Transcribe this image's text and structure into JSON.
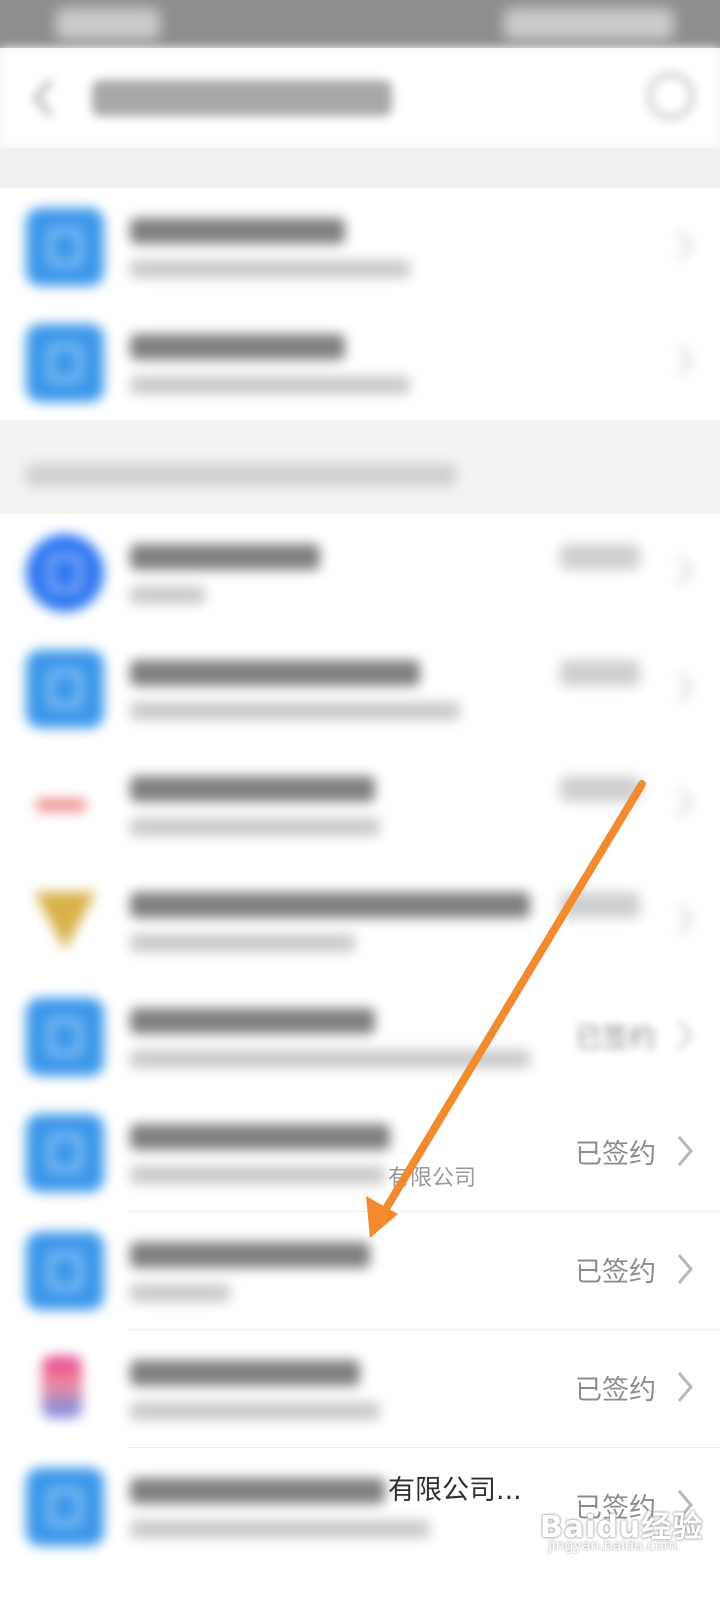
{
  "list": {
    "status_signed": "已签约",
    "rows": [
      {
        "sub_partial": "有限公司"
      },
      {
        "sub_partial": ""
      },
      {
        "title_partial": ""
      },
      {
        "sub_partial": ""
      },
      {
        "title_partial": "有限公司..."
      }
    ]
  },
  "watermark": {
    "text": "Baidu经验",
    "url": "jingyan.baidu.com"
  },
  "annotation": {
    "arrow_color": "#f28a30"
  }
}
